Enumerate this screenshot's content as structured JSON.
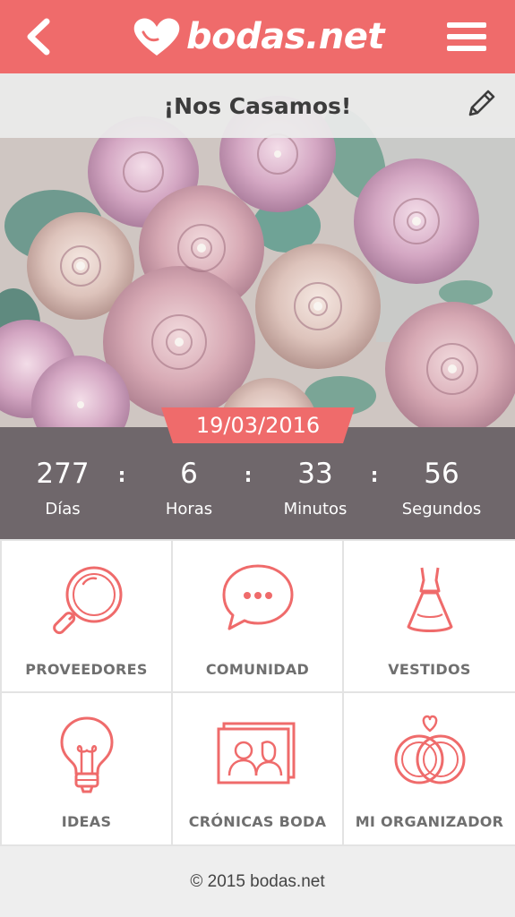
{
  "header": {
    "logo_text": "bodas.net",
    "back_icon": "chevron-left-icon",
    "menu_icon": "hamburger-menu-icon",
    "brand_color": "#ef6b6b"
  },
  "hero": {
    "title": "¡Nos Casamos!",
    "edit_icon": "pencil-icon",
    "image_subject": "bouquet of pink roses",
    "date": "19/03/2016"
  },
  "countdown": {
    "items": [
      {
        "value": "277",
        "label": "Días"
      },
      {
        "value": "6",
        "label": "Horas"
      },
      {
        "value": "33",
        "label": "Minutos"
      },
      {
        "value": "56",
        "label": "Segundos"
      }
    ],
    "separator": ":"
  },
  "menu": {
    "tiles": [
      {
        "label": "PROVEEDORES",
        "icon": "magnifier-icon"
      },
      {
        "label": "COMUNIDAD",
        "icon": "chat-bubble-icon"
      },
      {
        "label": "VESTIDOS",
        "icon": "dress-icon"
      },
      {
        "label": "IDEAS",
        "icon": "lightbulb-icon"
      },
      {
        "label": "CRÓNICAS BODA",
        "icon": "photo-frame-icon"
      },
      {
        "label": "MI ORGANIZADOR",
        "icon": "wedding-rings-icon"
      }
    ]
  },
  "footer": {
    "text": "© 2015 bodas.net"
  }
}
